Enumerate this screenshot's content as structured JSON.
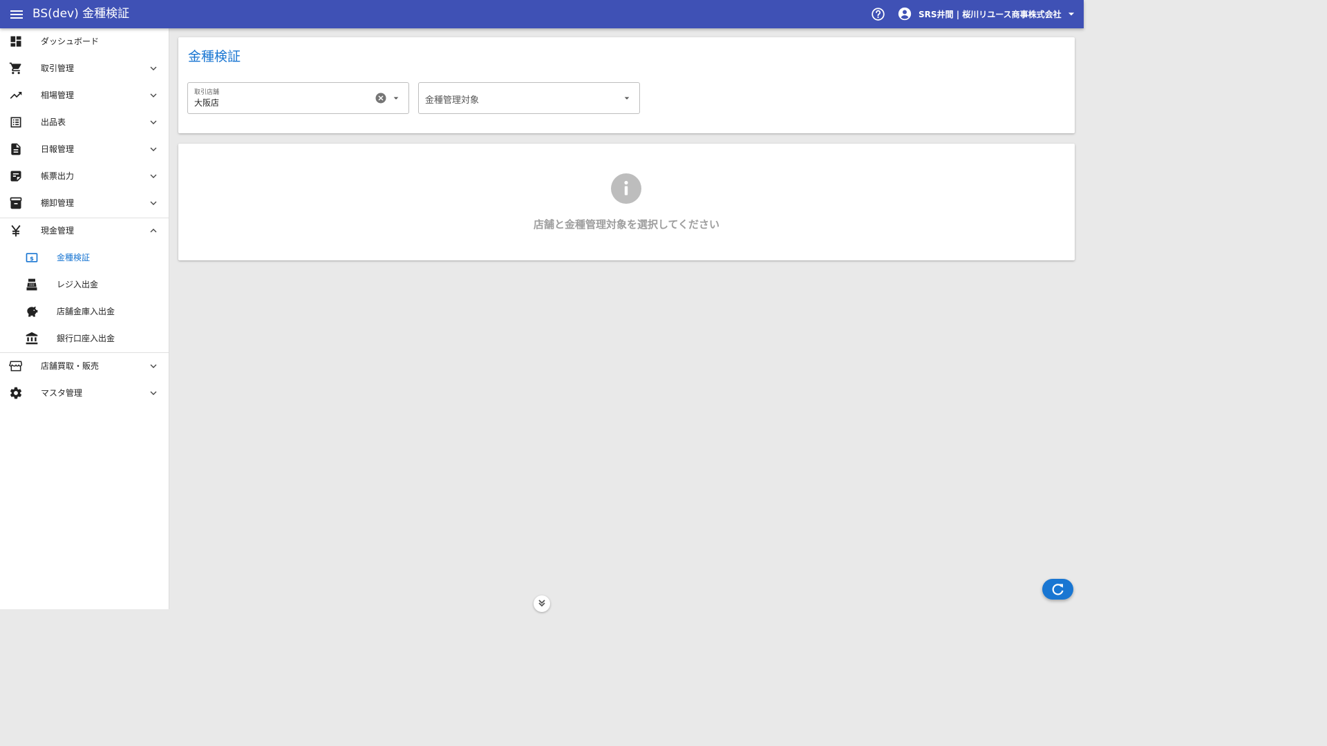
{
  "appbar": {
    "title": "BS(dev) 金種検証",
    "user_name": "SRS井間 | 桜川リユース商事株式会社",
    "colors": {
      "primary": "#3f51b5",
      "accent": "#1976d2"
    }
  },
  "sidebar": {
    "items": [
      {
        "label": "ダッシュボード",
        "icon": "dashboard-icon",
        "expandable": false
      },
      {
        "label": "取引管理",
        "icon": "cart-icon",
        "expandable": true,
        "expanded": false
      },
      {
        "label": "相場管理",
        "icon": "trending-up-icon",
        "expandable": true,
        "expanded": false
      },
      {
        "label": "出品表",
        "icon": "list-icon",
        "expandable": true,
        "expanded": false
      },
      {
        "label": "日報管理",
        "icon": "document-icon",
        "expandable": true,
        "expanded": false
      },
      {
        "label": "帳票出力",
        "icon": "sticky-note-icon",
        "expandable": true,
        "expanded": false
      },
      {
        "label": "棚卸管理",
        "icon": "archive-icon",
        "expandable": true,
        "expanded": false
      },
      {
        "label": "現金管理",
        "icon": "yen-icon",
        "expandable": true,
        "expanded": true
      },
      {
        "label": "店舗買取・販売",
        "icon": "store-icon",
        "expandable": true,
        "expanded": false
      },
      {
        "label": "マスタ管理",
        "icon": "gear-icon",
        "expandable": true,
        "expanded": false
      }
    ],
    "cash_subitems": [
      {
        "label": "金種検証",
        "icon": "money-icon",
        "active": true
      },
      {
        "label": "レジ入出金",
        "icon": "cash-register-icon",
        "active": false
      },
      {
        "label": "店舗金庫入出金",
        "icon": "piggy-bank-icon",
        "active": false
      },
      {
        "label": "銀行口座入出金",
        "icon": "bank-icon",
        "active": false
      }
    ]
  },
  "main": {
    "title": "金種検証",
    "store_field": {
      "label": "取引店舗",
      "value": "大阪店"
    },
    "target_field": {
      "placeholder": "金種管理対象"
    },
    "info": {
      "icon_text": "i",
      "message": "店舗と金種管理対象を選択してください"
    }
  }
}
